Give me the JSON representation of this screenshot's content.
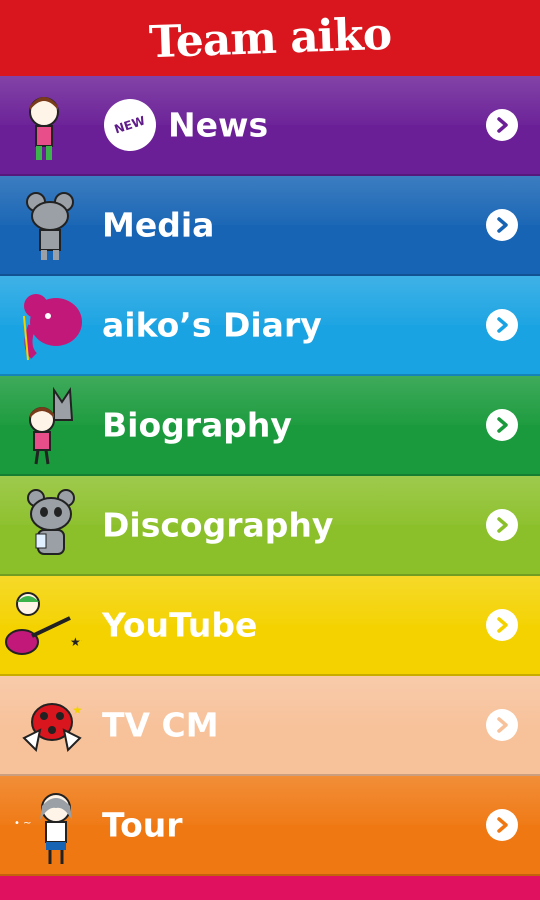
{
  "header": {
    "title": "Team aiko"
  },
  "menu": {
    "items": [
      {
        "label": "News",
        "badge": "NEW",
        "color": "#6a1f96",
        "character": "girl-icon"
      },
      {
        "label": "Media",
        "color": "#1764b4",
        "character": "mouse-icon"
      },
      {
        "label": "aiko’s Diary",
        "color": "#1aa3e2",
        "character": "elephant-icon"
      },
      {
        "label": "Biography",
        "color": "#1a9a3c",
        "character": "girl-with-animal-icon"
      },
      {
        "label": "Discography",
        "color": "#8cc02b",
        "character": "bear-icon"
      },
      {
        "label": "YouTube",
        "color": "#f4d200",
        "character": "guitar-girl-icon"
      },
      {
        "label": "TV CM",
        "color": "#f7c19a",
        "character": "ladybug-icon"
      },
      {
        "label": "Tour",
        "color": "#ef7812",
        "character": "tour-girl-icon"
      }
    ]
  }
}
